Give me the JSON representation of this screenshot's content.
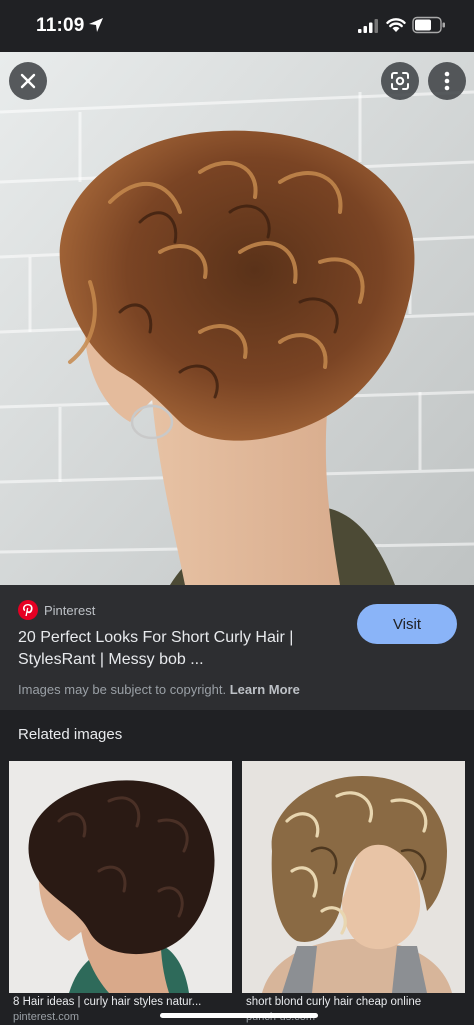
{
  "status_bar": {
    "time": "11:09"
  },
  "viewer": {
    "close_icon": "close-icon",
    "lens_icon": "lens-icon",
    "more_icon": "more-vert-icon"
  },
  "result": {
    "source": "Pinterest",
    "title_line1": "20 Perfect Looks For Short Curly Hair |",
    "title_line2": "StylesRant | Messy bob ...",
    "visit_label": "Visit",
    "copyright_text": "Images may be subject to copyright.",
    "learn_more": "Learn More"
  },
  "related": {
    "heading": "Related images",
    "items": [
      {
        "caption": "8 Hair ideas | curly hair styles natur...",
        "source": "pinterest.com"
      },
      {
        "caption": "short blond curly hair cheap online",
        "source": "punch-us.com"
      }
    ]
  },
  "colors": {
    "accent": "#8ab4f8",
    "background": "#202124",
    "panel": "#2d2e31",
    "pinterest": "#e60023"
  }
}
